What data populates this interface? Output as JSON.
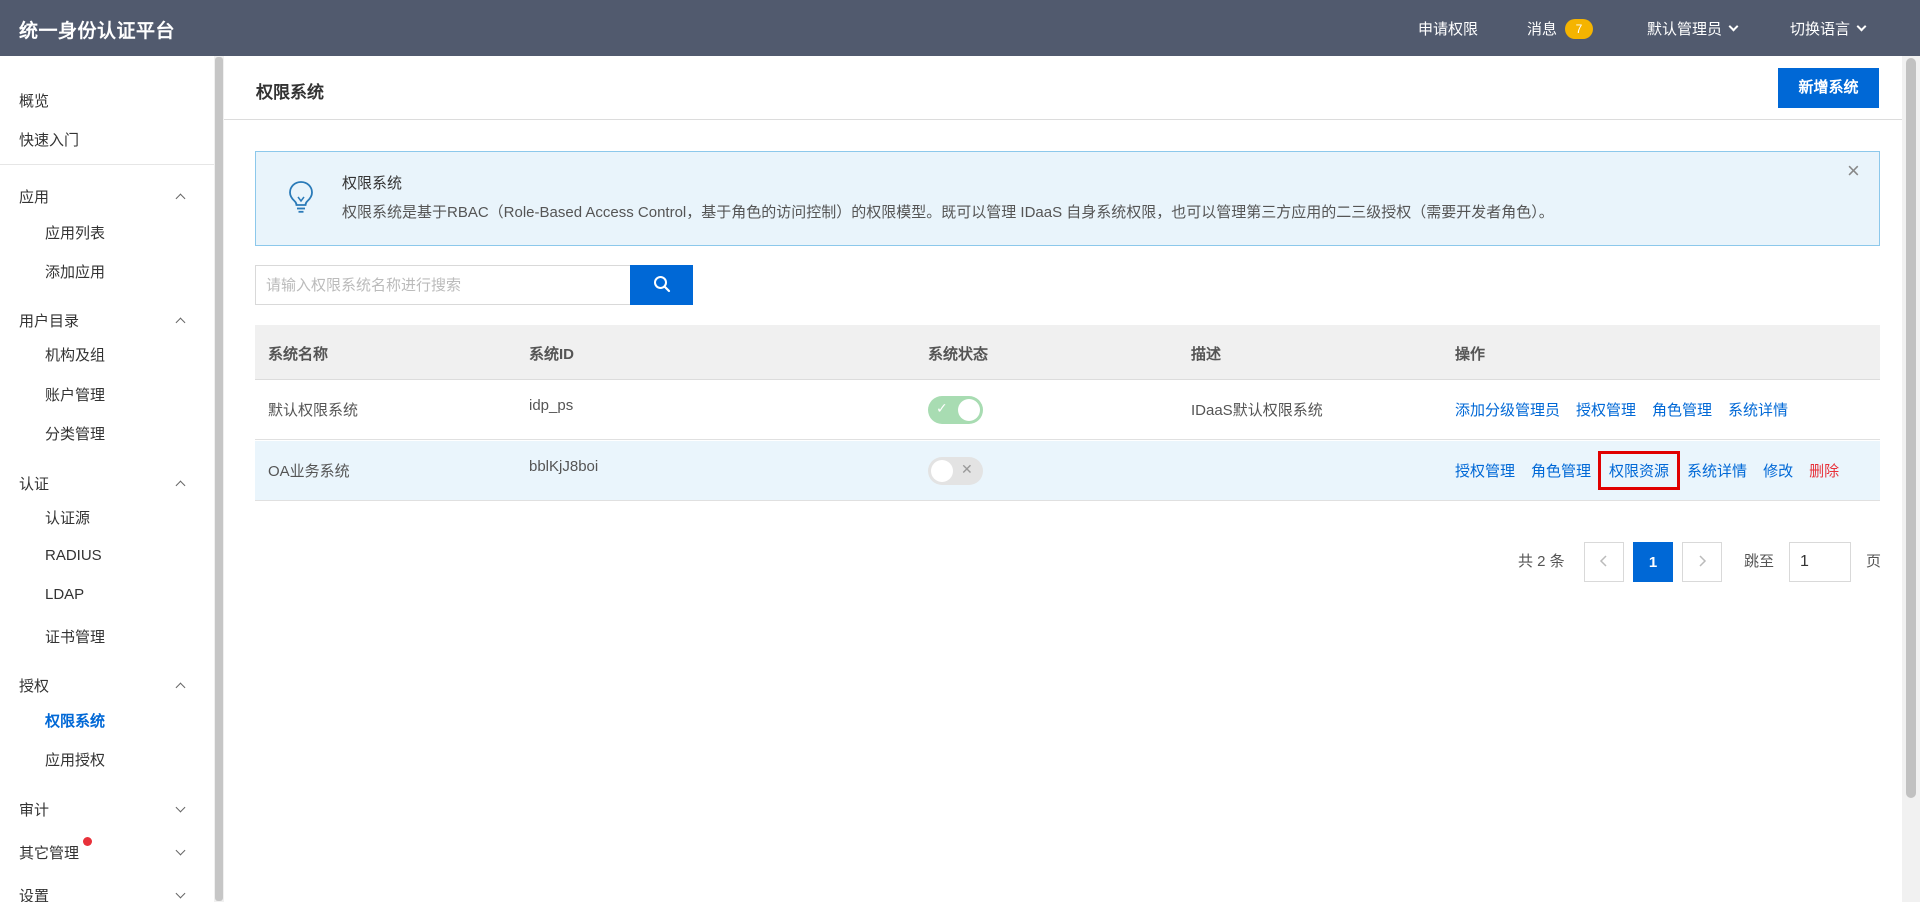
{
  "topbar": {
    "brand": "统一身份认证平台",
    "apply_permission": "申请权限",
    "messages_label": "消息",
    "messages_count": "7",
    "admin_label": "默认管理员",
    "language_label": "切换语言"
  },
  "sidebar": {
    "overview": "概览",
    "quickstart": "快速入门",
    "groups": {
      "apps": "应用",
      "directory": "用户目录",
      "auth": "认证",
      "authorization": "授权",
      "audit": "审计",
      "other": "其它管理",
      "settings": "设置"
    },
    "apps_items": [
      "应用列表",
      "添加应用"
    ],
    "directory_items": [
      "机构及组",
      "账户管理",
      "分类管理"
    ],
    "auth_items": [
      "认证源",
      "RADIUS",
      "LDAP",
      "证书管理"
    ],
    "authorization_items": [
      "权限系统",
      "应用授权"
    ]
  },
  "main": {
    "title": "权限系统",
    "add_button": "新增系统",
    "alert": {
      "title": "权限系统",
      "text": "权限系统是基于RBAC（Role-Based Access Control，基于角色的访问控制）的权限模型。既可以管理 IDaaS 自身系统权限，也可以管理第三方应用的二三级授权（需要开发者角色）。"
    },
    "search_placeholder": "请输入权限系统名称进行搜索",
    "table": {
      "headers": [
        "系统名称",
        "系统ID",
        "系统状态",
        "描述",
        "操作"
      ],
      "rows": [
        {
          "name": "默认权限系统",
          "id": "idp_ps",
          "status": "on",
          "desc": "IDaaS默认权限系统",
          "ops": [
            "添加分级管理员",
            "授权管理",
            "角色管理",
            "系统详情"
          ]
        },
        {
          "name": "OA业务系统",
          "id": "bblKjJ8boi",
          "status": "off",
          "desc": "",
          "ops": [
            "授权管理",
            "角色管理",
            "权限资源",
            "系统详情",
            "修改",
            "删除"
          ]
        }
      ]
    },
    "pagination": {
      "total": "共 2 条",
      "current_page": "1",
      "jump_label": "跳至",
      "jump_value": "1",
      "page_suffix": "页"
    }
  },
  "colors": {
    "topbar": "#515a6e",
    "primary": "#0068d6",
    "danger": "#e8313a",
    "badge": "#f5b400",
    "alert_bg": "#e9f4fb"
  }
}
